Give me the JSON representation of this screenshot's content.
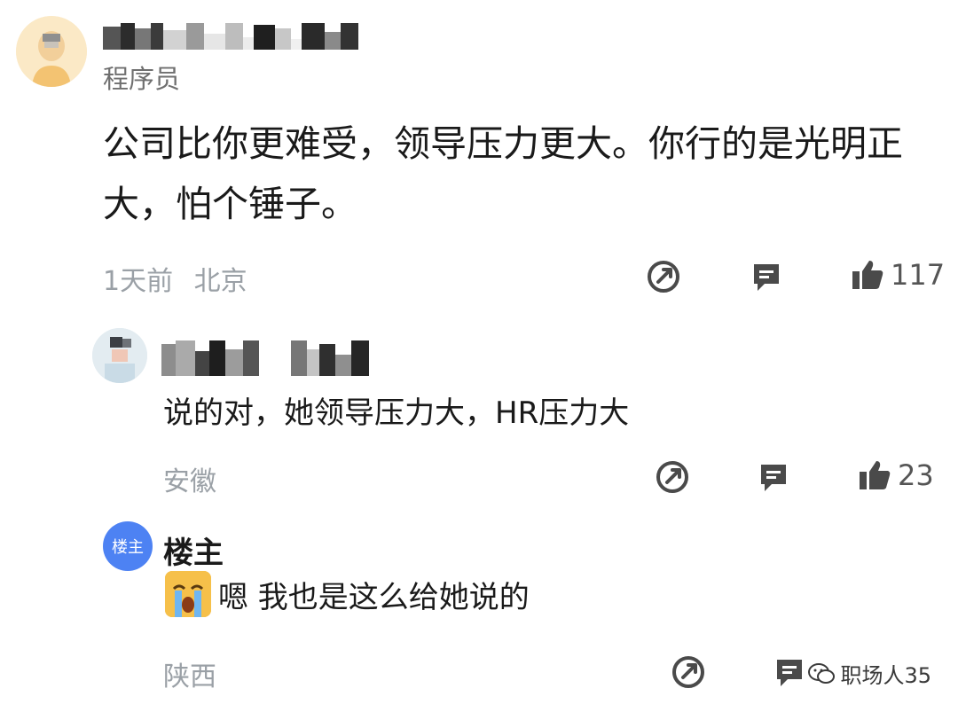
{
  "top_comment": {
    "role": "程序员",
    "text": "公司比你更难受，领导压力更大。你行的是光明正大，怕个锤子。",
    "time": "1天前",
    "location": "北京",
    "like_count": "117"
  },
  "reply1": {
    "text": "说的对，她领导压力大，HR压力大",
    "location": "安徽",
    "like_count": "23"
  },
  "reply2": {
    "avatar_label": "楼主",
    "author": "楼主",
    "text": "嗯 我也是这么给她说的",
    "location": "陕西"
  },
  "watermark": "职场人35"
}
